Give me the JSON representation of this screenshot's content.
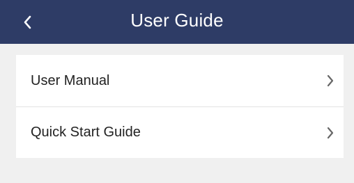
{
  "header": {
    "title": "User Guide",
    "back_icon": "chevron-left-icon",
    "background_color": "#2e3c66"
  },
  "menu": {
    "items": [
      {
        "label": "User Manual",
        "icon": "chevron-right-icon"
      },
      {
        "label": "Quick Start Guide",
        "icon": "chevron-right-icon"
      }
    ]
  }
}
